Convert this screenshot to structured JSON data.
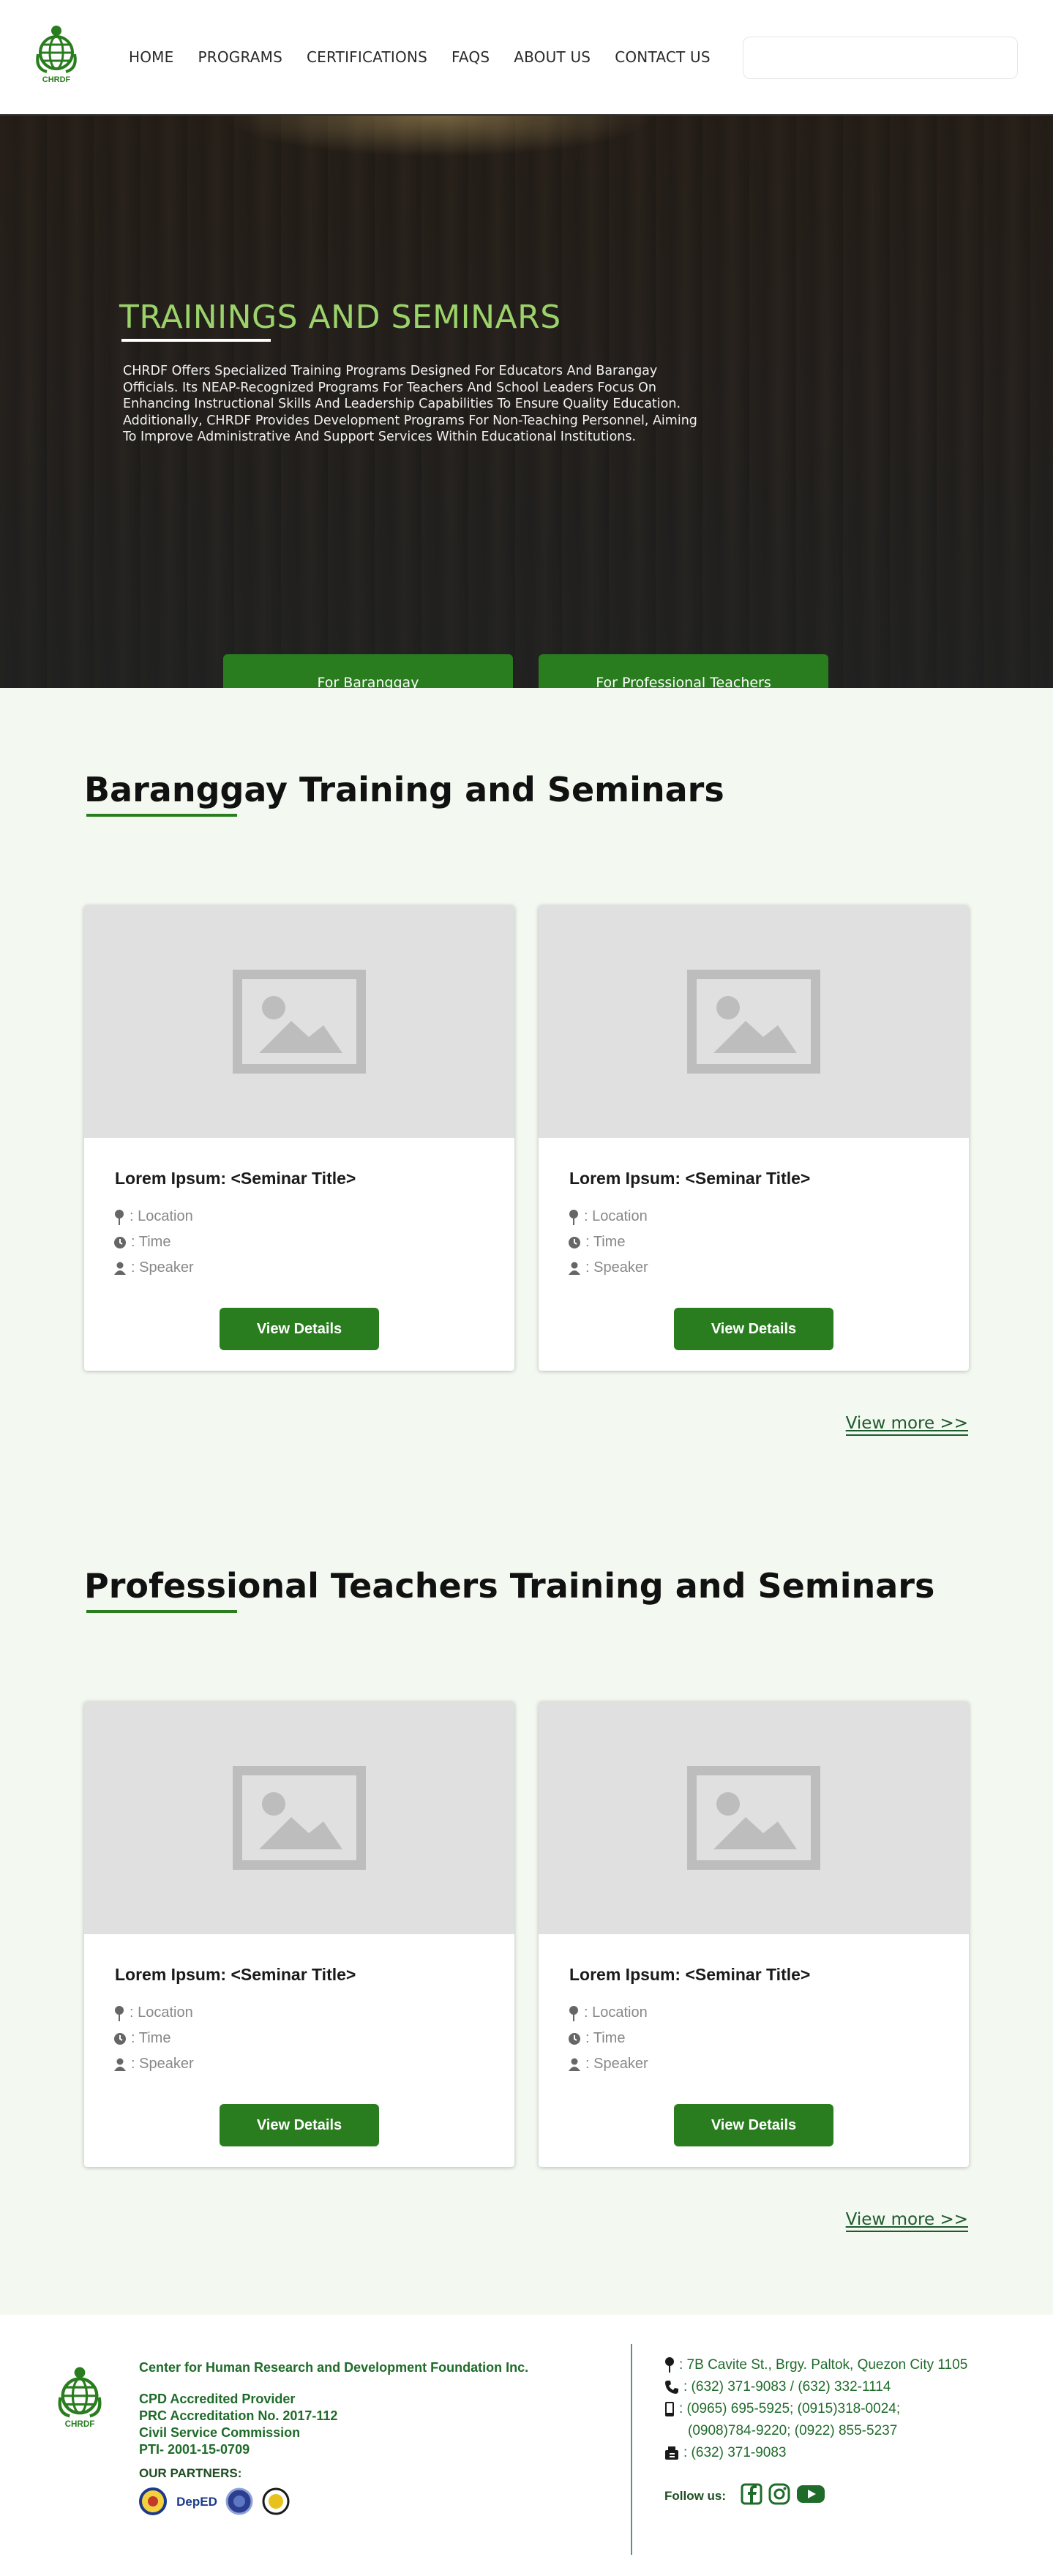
{
  "header": {
    "logo_text": "CHRDF",
    "nav": [
      "HOME",
      "PROGRAMS",
      "CERTIFICATIONS",
      "FAQS",
      "ABOUT US",
      "CONTACT US"
    ],
    "search_value": ""
  },
  "hero": {
    "title": "TRAININGS AND SEMINARS",
    "description": "CHRDF Offers Specialized Training Programs Designed For Educators And Barangay Officials. Its NEAP-Recognized Programs For Teachers And School Leaders Focus On Enhancing Instructional Skills And Leadership Capabilities To Ensure Quality Education. Additionally, CHRDF Provides Development Programs For Non-Teaching Personnel, Aiming To Improve Administrative And Support Services Within Educational Institutions.",
    "buttons": [
      "For Baranggay",
      "For Professional Teachers"
    ]
  },
  "sections": [
    {
      "title": "Baranggay Training and Seminars",
      "cards": [
        {
          "title": "Lorem Ipsum: <Seminar Title>",
          "location": ": Location",
          "time": ": Time",
          "speaker": ": Speaker",
          "button": "View Details"
        },
        {
          "title": "Lorem Ipsum: <Seminar Title>",
          "location": ": Location",
          "time": ": Time",
          "speaker": ": Speaker",
          "button": "View Details"
        }
      ],
      "view_more": "View more >>"
    },
    {
      "title": "Professional Teachers Training and Seminars",
      "cards": [
        {
          "title": "Lorem Ipsum: <Seminar Title>",
          "location": ": Location",
          "time": ": Time",
          "speaker": ": Speaker",
          "button": "View Details"
        },
        {
          "title": "Lorem Ipsum: <Seminar Title>",
          "location": ": Location",
          "time": ": Time",
          "speaker": ": Speaker",
          "button": "View Details"
        }
      ],
      "view_more": "View more >>"
    }
  ],
  "footer": {
    "logo_text": "CHRDF",
    "org_name": "Center for Human Research and Development Foundation Inc.",
    "credentials": [
      "CPD Accredited Provider",
      "PRC Accreditation No. 2017-112",
      "Civil Service Commission",
      "PTI- 2001-15-0709"
    ],
    "partners_label": "OUR PARTNERS:",
    "partners": [
      "partner-seal-1",
      "DepED",
      "partner-seal-3",
      "partner-seal-4"
    ],
    "address": ": 7B Cavite St., Brgy. Paltok, Quezon City 1105",
    "phone": ": (632) 371-9083 / (632) 332-1114",
    "mobile_1": ": (0965) 695-5925; (0915)318-0024;",
    "mobile_2": "(0908)784-9220; (0922) 855-5237",
    "fax": ": (632) 371-9083",
    "follow_label": "Follow us:",
    "socials": [
      "facebook-icon",
      "instagram-icon",
      "youtube-icon"
    ]
  },
  "colors": {
    "brand_green": "#2a7d1f",
    "hero_title_green": "#9bd36a",
    "footer_text_green": "#1f6b2a",
    "page_bg": "#f3f9f1"
  }
}
